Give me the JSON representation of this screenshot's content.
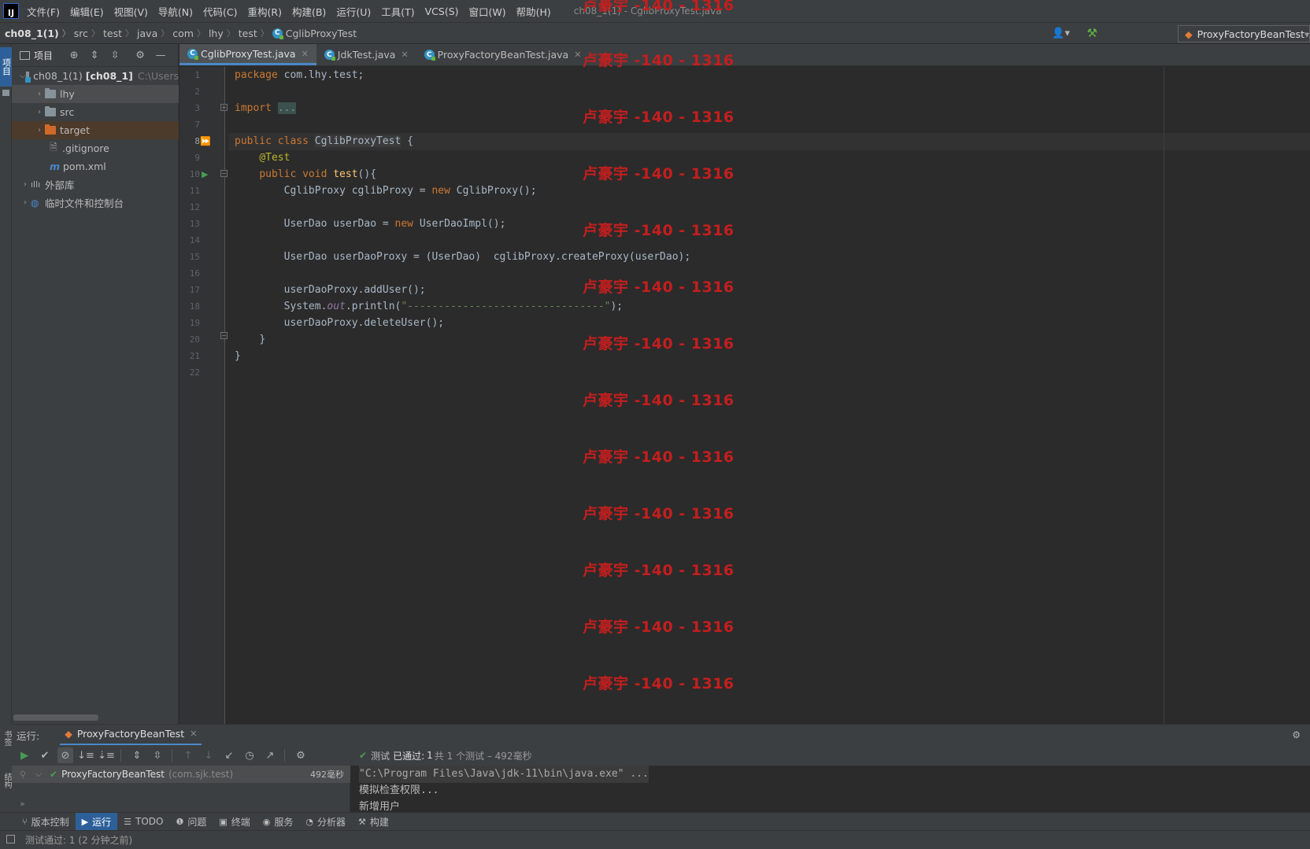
{
  "menubar": {
    "items": [
      "文件(F)",
      "编辑(E)",
      "视图(V)",
      "导航(N)",
      "代码(C)",
      "重构(R)",
      "构建(B)",
      "运行(U)",
      "工具(T)",
      "VCS(S)",
      "窗口(W)",
      "帮助(H)"
    ],
    "window_title": "ch08_1(1) - CglibProxyTest.java"
  },
  "breadcrumb": {
    "items": [
      "ch08_1(1)",
      "src",
      "test",
      "java",
      "com",
      "lhy",
      "test",
      "CglibProxyTest"
    ]
  },
  "run_config": {
    "name": "ProxyFactoryBeanTest"
  },
  "left_strip": {
    "project_label": "项目"
  },
  "project_panel": {
    "title": "项目",
    "tree": [
      {
        "label": "ch08_1(1)",
        "module": "[ch08_1]",
        "path": "C:\\Users"
      },
      {
        "label": "lhy"
      },
      {
        "label": "src"
      },
      {
        "label": "target"
      },
      {
        "label": ".gitignore"
      },
      {
        "label": "pom.xml"
      },
      {
        "label": "外部库"
      },
      {
        "label": "临时文件和控制台"
      }
    ]
  },
  "editor": {
    "tabs": [
      {
        "label": "CglibProxyTest.java"
      },
      {
        "label": "JdkTest.java"
      },
      {
        "label": "ProxyFactoryBeanTest.java"
      }
    ],
    "line_numbers": [
      "1",
      "2",
      "3",
      "7",
      "8",
      "9",
      "10",
      "11",
      "12",
      "13",
      "14",
      "15",
      "16",
      "17",
      "18",
      "19",
      "20",
      "21",
      "22"
    ],
    "code": {
      "l1_kw": "package",
      "l1_rest": " com.lhy.test;",
      "l3_kw": "import",
      "l3_fold": "...",
      "l8_kw": "public class ",
      "l8_cls": "CglibProxyTest",
      "l8_rest": " {",
      "l9_ann": "@Test",
      "l10_kw": "public void ",
      "l10_fn": "test",
      "l10_rest": "(){",
      "l11_a": "CglibProxy cglibProxy = ",
      "l11_kw": "new",
      "l11_b": " CglibProxy();",
      "l13_a": "UserDao userDao = ",
      "l13_kw": "new",
      "l13_b": " UserDaoImpl();",
      "l15": "UserDao userDaoProxy = (UserDao)  cglibProxy.createProxy(userDao);",
      "l17": "userDaoProxy.addUser();",
      "l18_a": "System.",
      "l18_it": "out",
      "l18_b": ".println(",
      "l18_str": "\"--------------------------------\"",
      "l18_c": ");",
      "l19": "userDaoProxy.deleteUser();",
      "l20": "}",
      "l21": "}"
    }
  },
  "watermark": {
    "text": "卢豪宇 -140 - 1316"
  },
  "run_panel": {
    "label": "运行:",
    "tab": "ProxyFactoryBeanTest",
    "status_prefix": "测试",
    "status_passed": "已通过:",
    "status_count": "1",
    "status_detail": "共 1 个测试 – 492毫秒",
    "tree_item": "ProxyFactoryBeanTest",
    "tree_pkg": "(com.sjk.test)",
    "tree_time": "492毫秒",
    "console": [
      "\"C:\\Program Files\\Java\\jdk-11\\bin\\java.exe\" ...",
      "模拟检查权限...",
      "新增用户"
    ],
    "side_labels": [
      "书签",
      "结构"
    ]
  },
  "bottom_tools": [
    {
      "label": "版本控制",
      "icon": "⑂"
    },
    {
      "label": "运行",
      "icon": "▶"
    },
    {
      "label": "TODO",
      "icon": "☰"
    },
    {
      "label": "问题",
      "icon": "❶"
    },
    {
      "label": "终端",
      "icon": "▣"
    },
    {
      "label": "服务",
      "icon": "◉"
    },
    {
      "label": "分析器",
      "icon": "◔"
    },
    {
      "label": "构建",
      "icon": "⚒"
    }
  ],
  "statusbar": {
    "text": "测试通过: 1 (2 分钟之前)"
  }
}
